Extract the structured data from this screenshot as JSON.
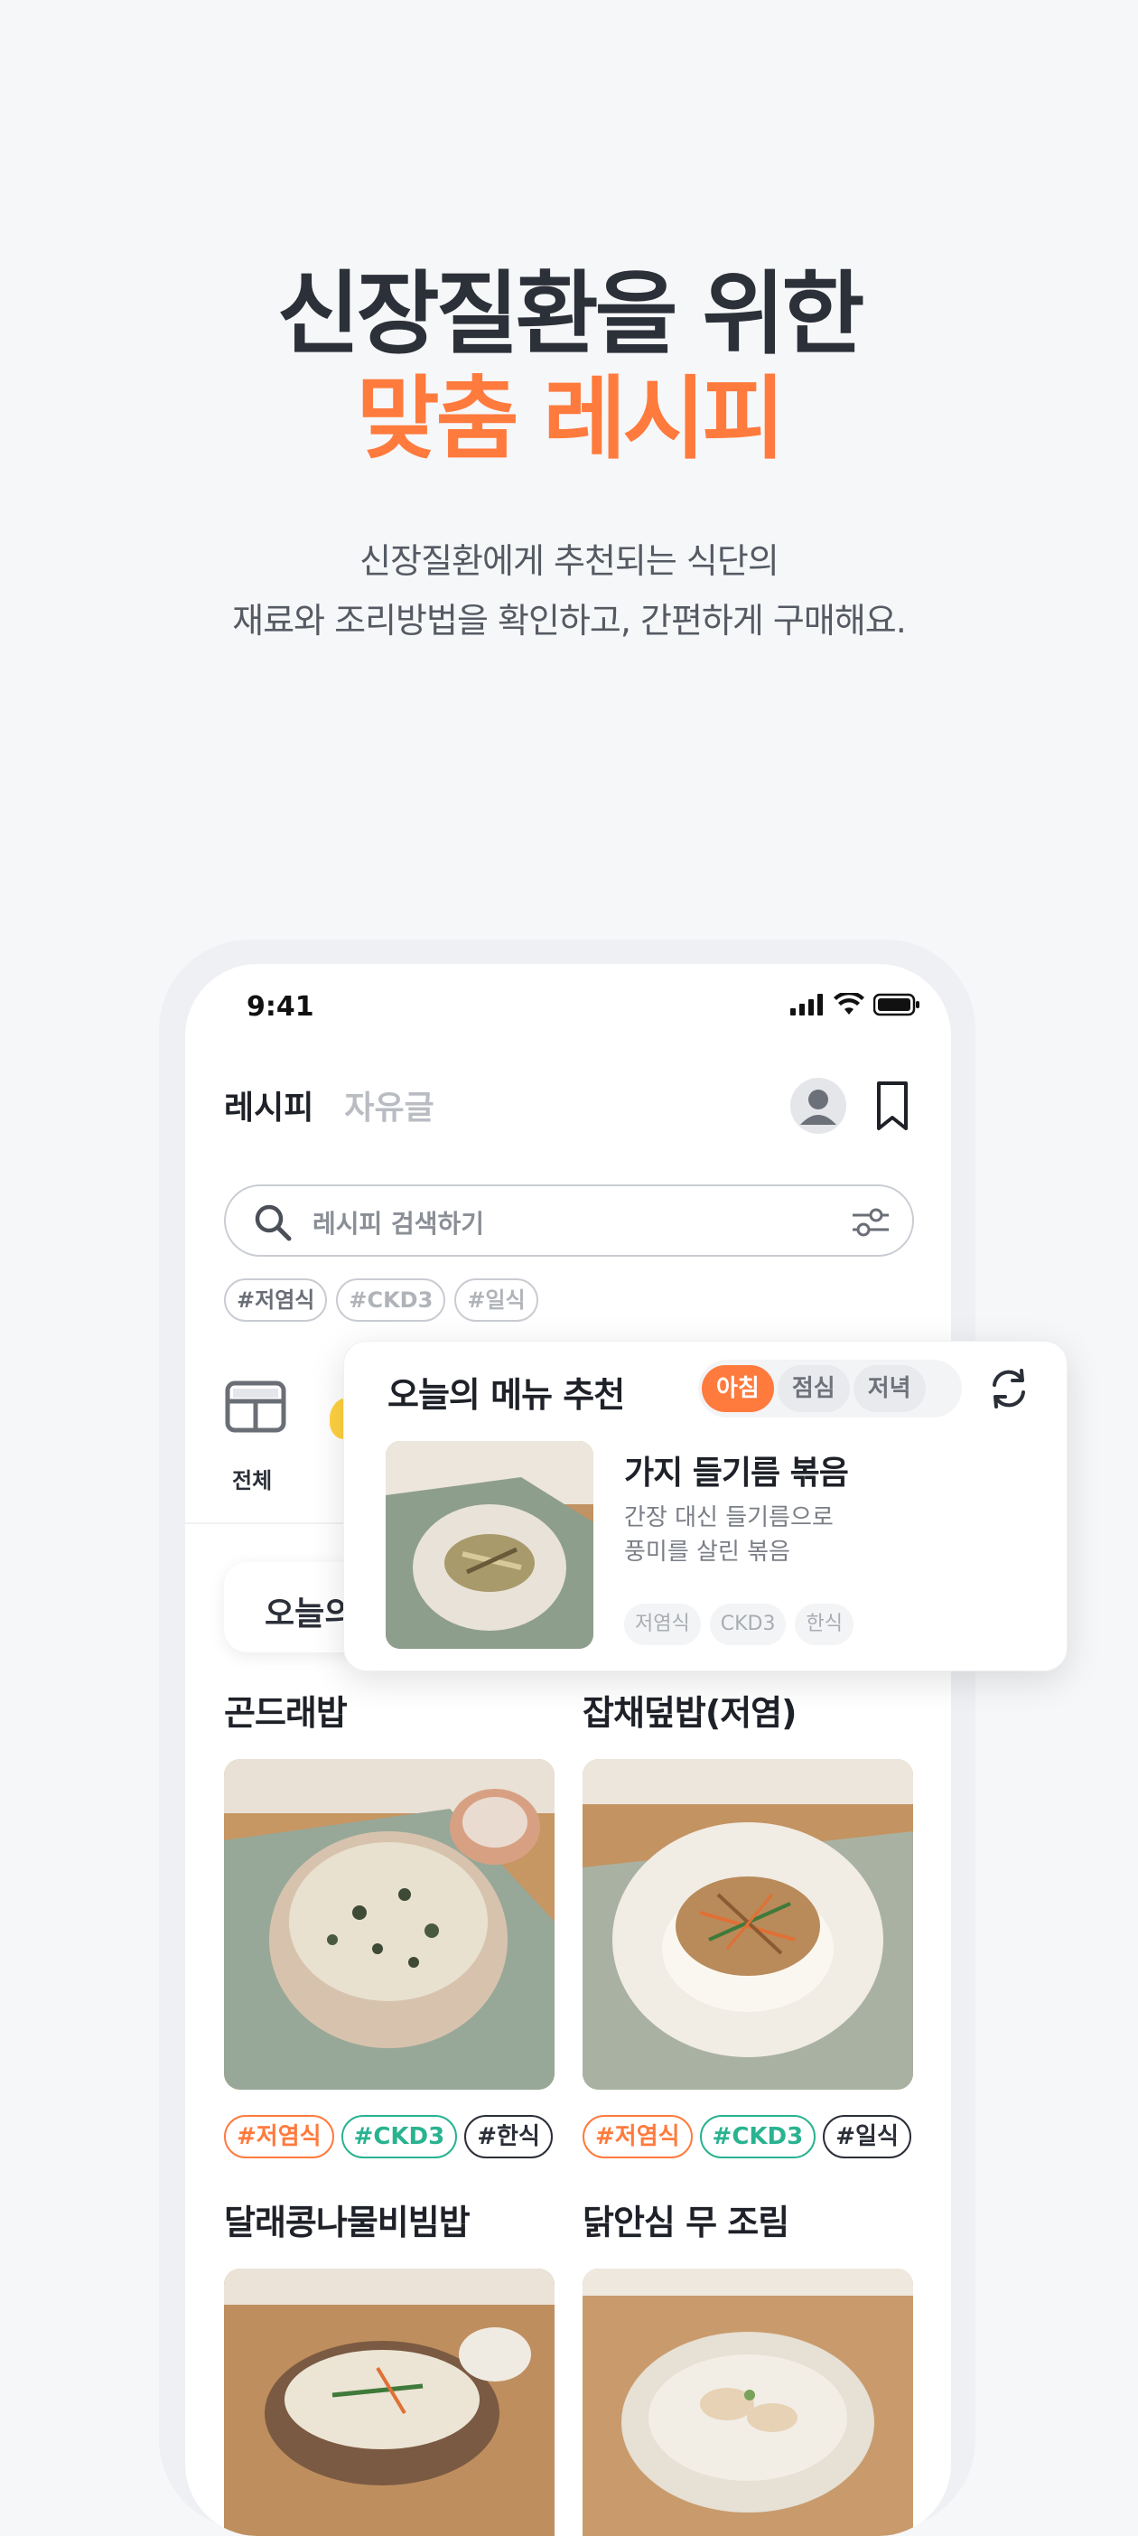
{
  "hero": {
    "title_line1": "신장질환을 위한",
    "title_line2": "맞춤 레시피",
    "subtitle_line1": "신장질환에게 추천되는 식단의",
    "subtitle_line2": "재료와 조리방법을 확인하고, 간편하게 구매해요."
  },
  "status": {
    "time": "9:41"
  },
  "tabs": {
    "active": "레시피",
    "inactive": "자유글"
  },
  "search": {
    "placeholder": "레시피 검색하기"
  },
  "top_chips": [
    "#저염식",
    "#CKD3",
    "#일식"
  ],
  "category": {
    "all_label": "전체"
  },
  "today_label": "오늘의",
  "menu_card": {
    "title": "오늘의 메뉴 추천",
    "meals": [
      "아침",
      "점심",
      "저녁"
    ],
    "selected_meal": "아침",
    "dish_name": "가지 들기름 볶음",
    "desc_line1": "간장 대신 들기름으로",
    "desc_line2": "풍미를 살린 볶음",
    "tags": [
      "저염식",
      "CKD3",
      "한식"
    ]
  },
  "recipes": [
    {
      "title": "곤드래밥",
      "tags": [
        "#저염식",
        "#CKD3",
        "#한식"
      ]
    },
    {
      "title": "잡채덮밥(저염)",
      "tags": [
        "#저염식",
        "#CKD3",
        "#일식"
      ]
    },
    {
      "title": "달래콩나물비빔밥"
    },
    {
      "title": "닭안심 무 조림"
    }
  ],
  "colors": {
    "accent": "#ff7a3d",
    "green": "#29b390",
    "dark": "#2b2f38"
  }
}
